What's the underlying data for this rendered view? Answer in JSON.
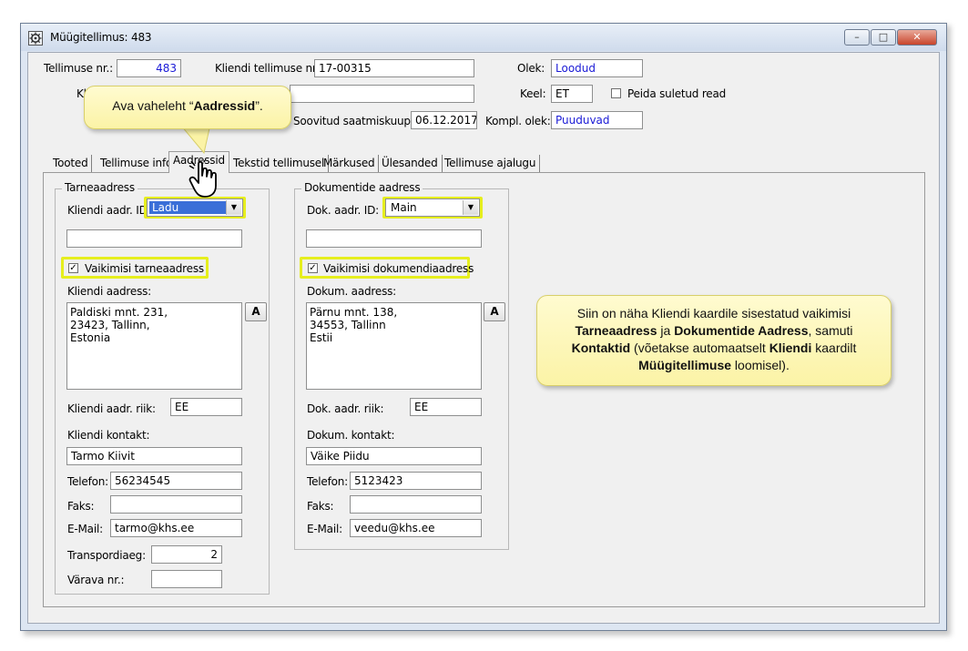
{
  "window": {
    "title": "Müügitellimus: 483",
    "controls": {
      "minimize": "–",
      "maximize": "□",
      "close": "✕"
    }
  },
  "header": {
    "order_no_label": "Tellimuse nr.:",
    "order_no": "483",
    "client_order_no_label": "Kliendi tellimuse nr.:",
    "client_order_no": "17-00315",
    "state_label": "Olek:",
    "state": "Loodud",
    "client_label_partial": "Kl",
    "language_label": "Keel:",
    "language": "ET",
    "hide_closed_label": "Peida suletud read",
    "hide_closed_checked": false,
    "delivery_date_label": "Soovitud saatmiskuup.:",
    "delivery_date": "06.12.2017",
    "completion_state_label": "Kompl. olek:",
    "completion_state": "Puuduvad"
  },
  "tabs": [
    {
      "label": "Tooted"
    },
    {
      "label": "Tellimuse info"
    },
    {
      "label": "Aadressid",
      "active": true
    },
    {
      "label": "Tekstid tellimusel"
    },
    {
      "label": "Märkused"
    },
    {
      "label": "Ülesanded"
    },
    {
      "label": "Tellimuse ajalugu"
    }
  ],
  "delivery": {
    "group_title": "Tarneaadress",
    "addr_id_label": "Kliendi aadr. ID:",
    "addr_id": "Ladu",
    "extra_field": "",
    "default_label": "Vaikimisi tarneaadress",
    "default_checked": true,
    "address_label": "Kliendi aadress:",
    "address": "Paldiski mnt. 231,\n23423, Tallinn,\nEstonia",
    "address_button": "A",
    "country_label": "Kliendi aadr. riik:",
    "country": "EE",
    "contact_label": "Kliendi kontakt:",
    "contact": "Tarmo Kiivit",
    "phone_label": "Telefon:",
    "phone": "56234545",
    "fax_label": "Faks:",
    "fax": "",
    "email_label": "E-Mail:",
    "email": "tarmo@khs.ee",
    "transport_days_label": "Transpordiaeg:",
    "transport_days": "2",
    "gate_label": "Värava nr.:",
    "gate": ""
  },
  "documents": {
    "group_title": "Dokumentide aadress",
    "addr_id_label": "Dok. aadr. ID:",
    "addr_id": "Main",
    "extra_field": "",
    "default_label": "Vaikimisi dokumendiaadress",
    "default_checked": true,
    "address_label": "Dokum. aadress:",
    "address": "Pärnu mnt. 138,\n34553, Tallinn\nEstii",
    "address_button": "A",
    "country_label": "Dok. aadr. riik:",
    "country": "EE",
    "contact_label": "Dokum. kontakt:",
    "contact": "Väike Piidu",
    "phone_label": "Telefon:",
    "phone": "5123423",
    "fax_label": "Faks:",
    "fax": "",
    "email_label": "E-Mail:",
    "email": "veedu@khs.ee"
  },
  "callouts": {
    "tab_hint_prefix": "Ava vaheleht “",
    "tab_hint_bold": "Aadressid",
    "tab_hint_suffix": "”.",
    "info_1": "Siin on näha Kliendi kaardile sisestatud vaikimisi",
    "info_2_bold_a": "Tarneaadress",
    "info_2_mid": " ja ",
    "info_2_bold_b": "Dokumentide Aadress",
    "info_2_end": ", samuti",
    "info_3_bold_a": "Kontaktid",
    "info_3_mid": " (võetakse automaatselt ",
    "info_3_bold_b": "Kliendi",
    "info_3_end": " kaardilt",
    "info_4_bold": "Müügitellimuse",
    "info_4_end": " loomisel)."
  },
  "colors": {
    "highlight": "#e6ee1e",
    "callout_fill": "#fbf3a6",
    "value_blue": "#1a1ad6",
    "selection": "#3a6fd8"
  }
}
